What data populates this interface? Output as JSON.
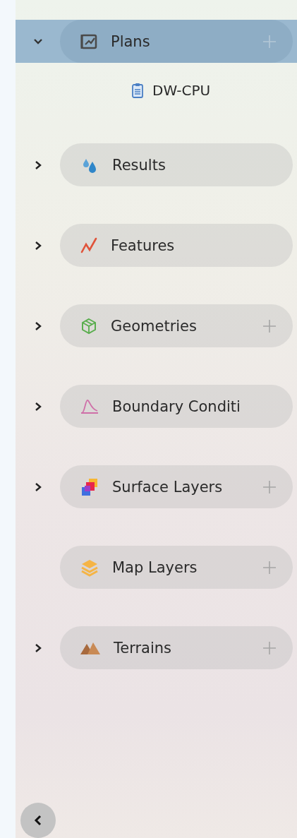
{
  "tree": {
    "items": [
      {
        "label": "Plans",
        "selected": true,
        "expandable": true,
        "expanded": true,
        "addable": true,
        "children": [
          {
            "label": "DW-CPU"
          }
        ]
      },
      {
        "label": "Results",
        "selected": false,
        "expandable": true,
        "expanded": false,
        "addable": false
      },
      {
        "label": "Features",
        "selected": false,
        "expandable": true,
        "expanded": false,
        "addable": false
      },
      {
        "label": "Geometries",
        "selected": false,
        "expandable": true,
        "expanded": false,
        "addable": true
      },
      {
        "label": "Boundary Conditi",
        "selected": false,
        "expandable": true,
        "expanded": false,
        "addable": false
      },
      {
        "label": "Surface Layers",
        "selected": false,
        "expandable": true,
        "expanded": false,
        "addable": true
      },
      {
        "label": "Map Layers",
        "selected": false,
        "expandable": false,
        "addable": true
      },
      {
        "label": "Terrains",
        "selected": false,
        "expandable": true,
        "expanded": false,
        "addable": true
      }
    ]
  }
}
